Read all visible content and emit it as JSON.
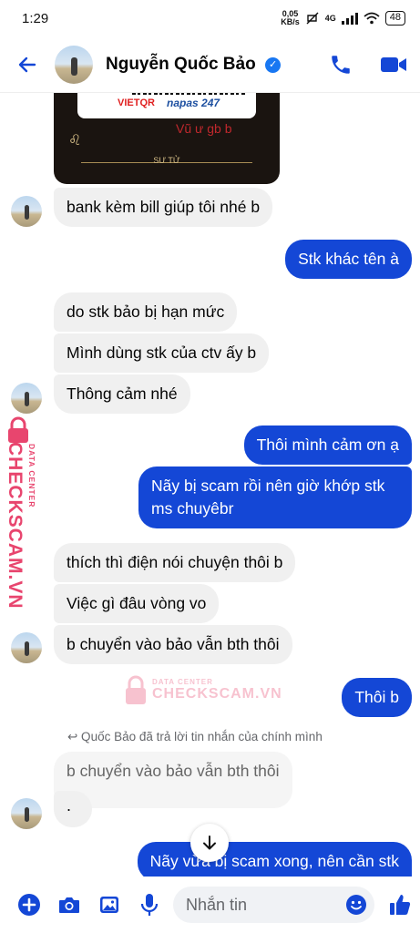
{
  "status_bar": {
    "time": "1:29",
    "net_speed_value": "0,05",
    "net_speed_unit": "KB/s",
    "network": "4G",
    "battery": "48"
  },
  "header": {
    "contact_name": "Nguyễn Quốc Bảo",
    "verified_mark": "✓",
    "icons": [
      "back-arrow-icon",
      "phone-icon",
      "video-camera-icon"
    ],
    "accent_color": "#1447d6"
  },
  "shared_image": {
    "brand_left": "VIETQR",
    "brand_right": "napas 247",
    "caption": "Vũ ư gb b",
    "zodiac_label": "SƯ TỬ",
    "zodiac_symbol": "♌"
  },
  "messages": [
    {
      "from": "contact",
      "text": "bank kèm bill giúp tôi nhé b"
    },
    {
      "from": "me",
      "text": "Stk khác tên à"
    },
    {
      "from": "contact",
      "text": "do stk bảo bị hạn mức"
    },
    {
      "from": "contact",
      "text": "Mình dùng stk của ctv ấy b"
    },
    {
      "from": "contact",
      "text": "Thông cảm nhé"
    },
    {
      "from": "me",
      "text": "Thôi mình cảm ơn ạ"
    },
    {
      "from": "me",
      "text_line1": "Nãy bị scam rồi nên giờ khớp stk",
      "text_line2": "ms chuyêbr"
    },
    {
      "from": "contact",
      "text": "thích thì điện nói chuyện thôi b"
    },
    {
      "from": "contact",
      "text": "Việc gì đâu vòng vo"
    },
    {
      "from": "contact",
      "text": "b chuyển vào bảo vẫn bth thôi"
    },
    {
      "from": "me",
      "text": "Thôi b"
    },
    {
      "from": "contact",
      "text": "."
    },
    {
      "from": "me",
      "text": "Nãy vừa bị scam xong, nên cần stk"
    }
  ],
  "reply_note": "↩ Quốc Bảo đã trả lời tin nhắn của chính mình",
  "quoted_text": "b chuyển vào bảo vẫn bth thôi",
  "watermark": {
    "small": "DATA CENTER",
    "big": "CHECKSCAM.VN",
    "color": "#e8456e"
  },
  "composer": {
    "placeholder": "Nhắn tin",
    "icons": [
      "plus-circle-icon",
      "camera-icon",
      "gallery-icon",
      "microphone-icon",
      "emoji-icon",
      "thumbs-up-icon"
    ]
  }
}
